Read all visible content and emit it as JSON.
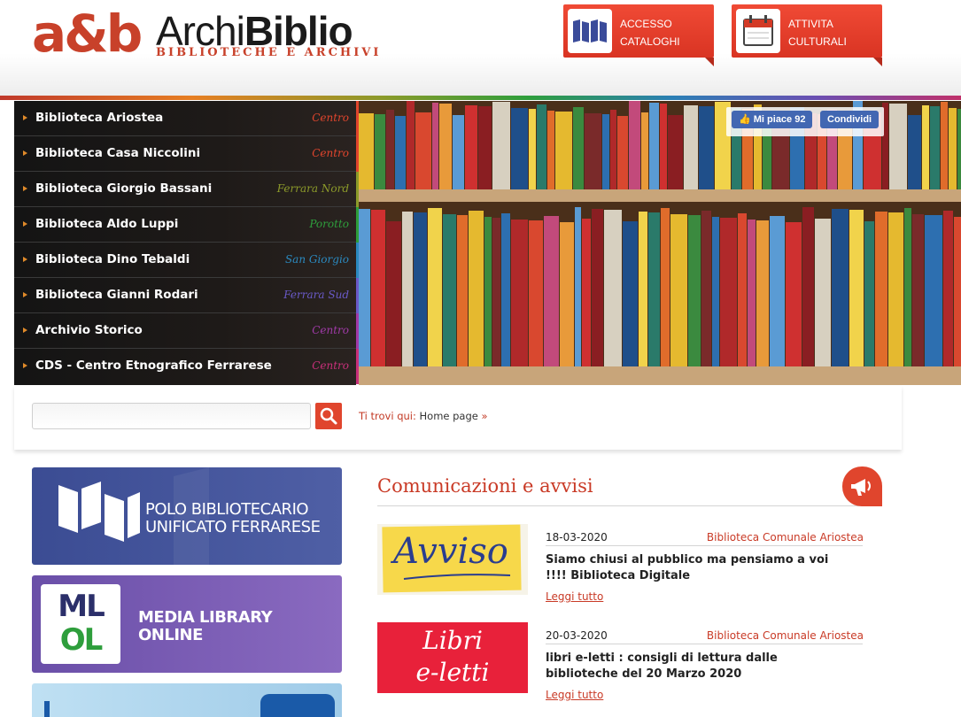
{
  "logo": {
    "mark": "a&b",
    "name_light": "Archi",
    "name_bold": "Biblio",
    "subtitle": "BIBLIOTECHE E ARCHIVI"
  },
  "header_buttons": [
    {
      "line1": "ACCESSO",
      "line2": "CATALOGHI",
      "icon": "catalog-books-icon"
    },
    {
      "line1": "ATTIVITA",
      "line2": "CULTURALI",
      "icon": "calendar-icon"
    }
  ],
  "libraries": [
    {
      "name": "Biblioteca Ariostea",
      "zone": "Centro",
      "color": "#e0452d"
    },
    {
      "name": "Biblioteca Casa Niccolini",
      "zone": "Centro",
      "color": "#e0452d"
    },
    {
      "name": "Biblioteca Giorgio Bassani",
      "zone": "Ferrara Nord",
      "color": "#8c9a2a"
    },
    {
      "name": "Biblioteca Aldo Luppi",
      "zone": "Porotto",
      "color": "#2e9e3c"
    },
    {
      "name": "Biblioteca Dino Tebaldi",
      "zone": "San Giorgio",
      "color": "#2b8ac0"
    },
    {
      "name": "Biblioteca Gianni Rodari",
      "zone": "Ferrara Sud",
      "color": "#6a5ac8"
    },
    {
      "name": "Archivio Storico",
      "zone": "Centro",
      "color": "#a03aa8"
    },
    {
      "name": "CDS - Centro Etnografico Ferrarese",
      "zone": "Centro",
      "color": "#c8307a"
    }
  ],
  "facebook": {
    "like": "Mi piace 92",
    "share": "Condividi"
  },
  "search": {
    "value": "",
    "placeholder": ""
  },
  "breadcrumb": {
    "lead": "Ti trovi qui:",
    "page": "Home page",
    "separator": "»"
  },
  "banners": {
    "polo": "POLO BIBLIOTECARIO\nUNIFICATO FERRARESE",
    "mlol_mark_top": "ML",
    "mlol_mark_bottom": "OL",
    "mlol": "MEDIA LIBRARY\nONLINE"
  },
  "news": {
    "title": "Comunicazioni e avvisi",
    "items": [
      {
        "date": "18-03-2020",
        "source": "Biblioteca Comunale Ariostea",
        "text": "Siamo chiusi al pubblico ma pensiamo a voi !!!! Biblioteca Digitale",
        "more": "Leggi tutto",
        "thumb_text": "Avviso"
      },
      {
        "date": "20-03-2020",
        "source": "Biblioteca Comunale Ariostea",
        "text": "libri e-letti : consigli di lettura dalle biblioteche del 20 Marzo 2020",
        "more": "Leggi tutto",
        "thumb_line1": "Libri",
        "thumb_line2": "e-letti"
      }
    ]
  }
}
